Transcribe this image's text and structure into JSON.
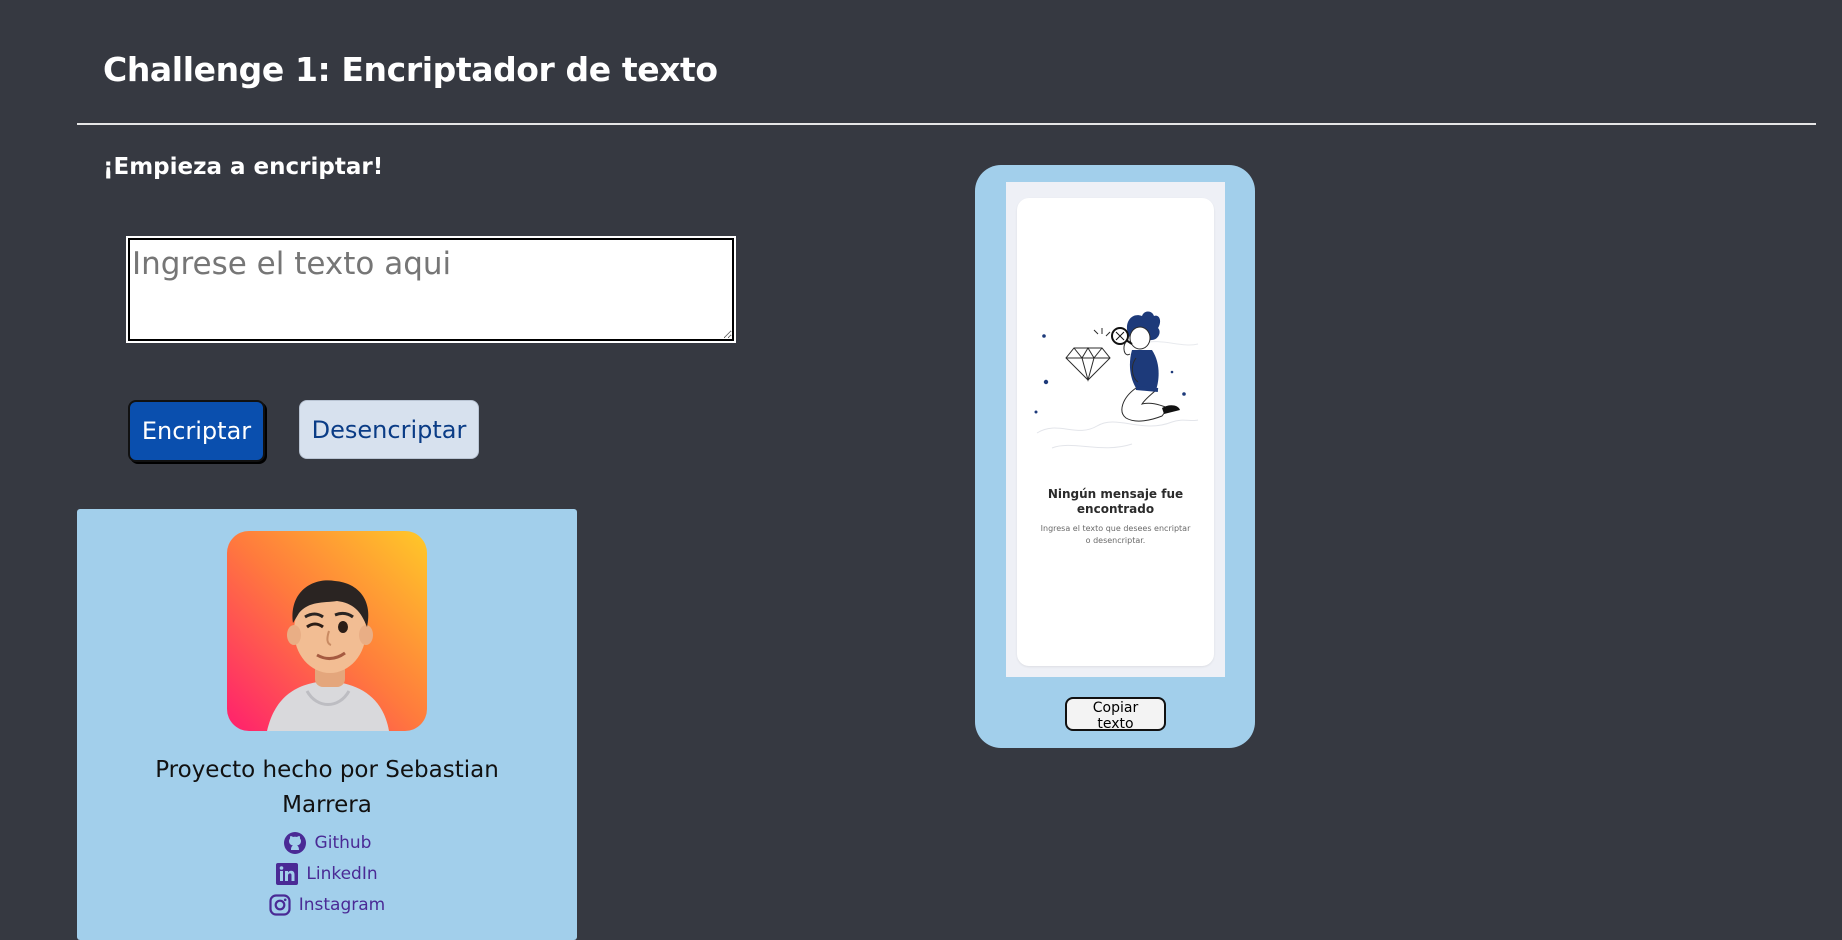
{
  "header": {
    "title": "Challenge 1: Encriptador de texto"
  },
  "main": {
    "subtitle": "¡Empieza a encriptar!",
    "input": {
      "value": "",
      "placeholder": "Ingrese el texto aqui"
    },
    "buttons": {
      "encrypt_label": "Encriptar",
      "decrypt_label": "Desencriptar"
    }
  },
  "profile": {
    "avatar_icon": "avatar-memoji",
    "author": "Proyecto hecho por Sebastian Marrera",
    "links": [
      {
        "label": "Github",
        "icon": "github-icon"
      },
      {
        "label": "LinkedIn",
        "icon": "linkedin-icon"
      },
      {
        "label": "Instagram",
        "icon": "instagram-icon"
      }
    ]
  },
  "output": {
    "empty_title": "Ningún mensaje fue encontrado",
    "empty_description": "Ingresa el texto que desees encriptar o desencriptar.",
    "copy_label": "Copiar texto"
  },
  "colors": {
    "background": "#363941",
    "card": "#a2cfeb",
    "primary_button": "#0a4fae",
    "secondary_button": "#d7e1ee",
    "link": "#4a2a95"
  }
}
